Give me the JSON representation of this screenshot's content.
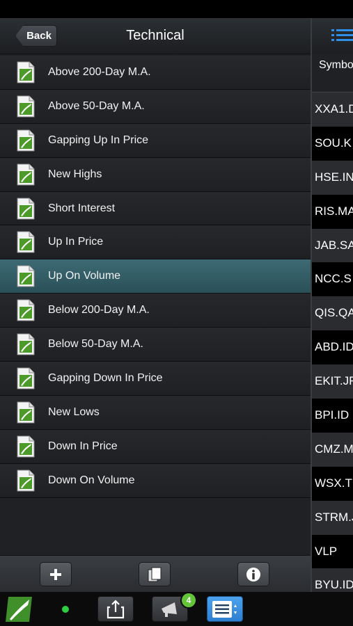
{
  "nav": {
    "back_label": "Back",
    "title": "Technical"
  },
  "list": {
    "items": [
      {
        "label": "Above 200-Day M.A."
      },
      {
        "label": "Above 50-Day M.A."
      },
      {
        "label": "Gapping Up In Price"
      },
      {
        "label": "New Highs"
      },
      {
        "label": "Short Interest"
      },
      {
        "label": "Up In Price"
      },
      {
        "label": "Up On Volume",
        "selected": true
      },
      {
        "label": "Below 200-Day M.A."
      },
      {
        "label": "Below 50-Day M.A."
      },
      {
        "label": "Gapping Down In Price"
      },
      {
        "label": "New Lows"
      },
      {
        "label": "Down In Price"
      },
      {
        "label": "Down On Volume"
      }
    ],
    "icon": "document-chart-icon"
  },
  "toolbar": {
    "add_icon": "plus-icon",
    "copy_icon": "copy-icon",
    "info_icon": "info-icon"
  },
  "right_panel": {
    "header": "Symbol",
    "symbols": [
      "XXA1.D",
      "SOU.K",
      "HSE.IN",
      "RIS.MA",
      "JAB.SA",
      "NCC.S",
      "QIS.QA",
      "ABD.ID",
      "EKIT.JF",
      "BPI.ID",
      "CMZ.M",
      "WSX.T",
      "STRM.J",
      "VLP",
      "BYU.ID"
    ]
  },
  "dock": {
    "alerts_badge": "4",
    "status_color": "#2ecc40",
    "icons": [
      "app-logo-icon",
      "status-dot-icon",
      "share-icon",
      "alerts-megaphone-icon",
      "list-view-icon"
    ]
  },
  "colors": {
    "accent_blue": "#2e8fe8",
    "selected_row": "#3d6a74",
    "badge_green": "#63c437",
    "icon_green": "#4c9a2a"
  }
}
